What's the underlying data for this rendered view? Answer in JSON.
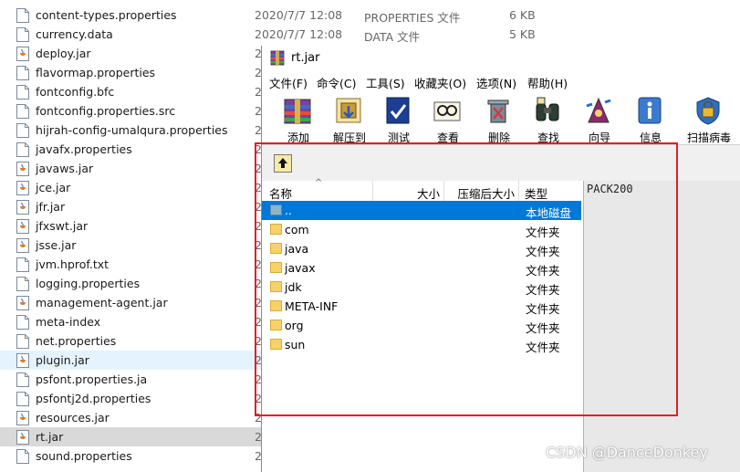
{
  "explorer": {
    "rows": [
      {
        "name": "content-types.properties",
        "date": "2020/7/7 12:08",
        "type": "PROPERTIES 文件",
        "size": "6 KB",
        "icon": "file-icon"
      },
      {
        "name": "currency.data",
        "date": "2020/7/7 12:08",
        "type": "DATA 文件",
        "size": "5 KB",
        "icon": "file-icon"
      },
      {
        "name": "deploy.jar",
        "date": "2",
        "icon": "jar-icon"
      },
      {
        "name": "flavormap.properties",
        "date": "2",
        "icon": "file-icon"
      },
      {
        "name": "fontconfig.bfc",
        "date": "2",
        "icon": "file-icon"
      },
      {
        "name": "fontconfig.properties.src",
        "date": "2",
        "icon": "file-icon"
      },
      {
        "name": "hijrah-config-umalqura.properties",
        "date": "2",
        "icon": "file-icon"
      },
      {
        "name": "javafx.properties",
        "date": "2",
        "icon": "file-icon"
      },
      {
        "name": "javaws.jar",
        "date": "2",
        "icon": "jar-icon"
      },
      {
        "name": "jce.jar",
        "date": "2",
        "icon": "jar-icon"
      },
      {
        "name": "jfr.jar",
        "date": "2",
        "icon": "jar-icon"
      },
      {
        "name": "jfxswt.jar",
        "date": "2",
        "icon": "jar-icon"
      },
      {
        "name": "jsse.jar",
        "date": "2",
        "icon": "jar-icon"
      },
      {
        "name": "jvm.hprof.txt",
        "date": "2",
        "icon": "file-icon"
      },
      {
        "name": "logging.properties",
        "date": "2",
        "icon": "file-icon"
      },
      {
        "name": "management-agent.jar",
        "date": "2",
        "icon": "jar-icon"
      },
      {
        "name": "meta-index",
        "date": "2",
        "icon": "file-icon"
      },
      {
        "name": "net.properties",
        "date": "2",
        "icon": "file-icon"
      },
      {
        "name": "plugin.jar",
        "date": "2",
        "icon": "jar-icon"
      },
      {
        "name": "psfont.properties.ja",
        "date": "2",
        "icon": "file-icon"
      },
      {
        "name": "psfontj2d.properties",
        "date": "2",
        "icon": "file-icon"
      },
      {
        "name": "resources.jar",
        "date": "2",
        "icon": "jar-icon"
      },
      {
        "name": "rt.jar",
        "date": "2",
        "icon": "jar-icon"
      },
      {
        "name": "sound.properties",
        "date": "2",
        "icon": "file-icon"
      }
    ]
  },
  "winrar": {
    "title": "rt.jar",
    "menu": [
      "文件(F)",
      "命令(C)",
      "工具(S)",
      "收藏夹(O)",
      "选项(N)",
      "帮助(H)"
    ],
    "toolbar": [
      {
        "label": "添加",
        "icon": "add-archive-icon"
      },
      {
        "label": "解压到",
        "icon": "extract-icon"
      },
      {
        "label": "测试",
        "icon": "test-icon"
      },
      {
        "label": "查看",
        "icon": "view-icon"
      },
      {
        "label": "删除",
        "icon": "delete-icon"
      },
      {
        "label": "查找",
        "icon": "find-icon"
      },
      {
        "label": "向导",
        "icon": "wizard-icon"
      },
      {
        "label": "信息",
        "icon": "info-icon"
      },
      {
        "label": "扫描病毒",
        "icon": "scan-virus-icon"
      }
    ],
    "columns": {
      "name": "名称",
      "size": "大小",
      "packed": "压缩后大小",
      "type": "类型"
    },
    "files": [
      {
        "name": "..",
        "type": "本地磁盘",
        "selected": true
      },
      {
        "name": "com",
        "type": "文件夹"
      },
      {
        "name": "java",
        "type": "文件夹"
      },
      {
        "name": "javax",
        "type": "文件夹"
      },
      {
        "name": "jdk",
        "type": "文件夹"
      },
      {
        "name": "META-INF",
        "type": "文件夹"
      },
      {
        "name": "org",
        "type": "文件夹"
      },
      {
        "name": "sun",
        "type": "文件夹"
      }
    ],
    "info_text": "PACK200"
  },
  "watermark": "CSDN @DanceDonkey",
  "colors": {
    "selection": "#0078d7",
    "highlight_box": "#e0202a",
    "folder": "#f6d26a"
  }
}
